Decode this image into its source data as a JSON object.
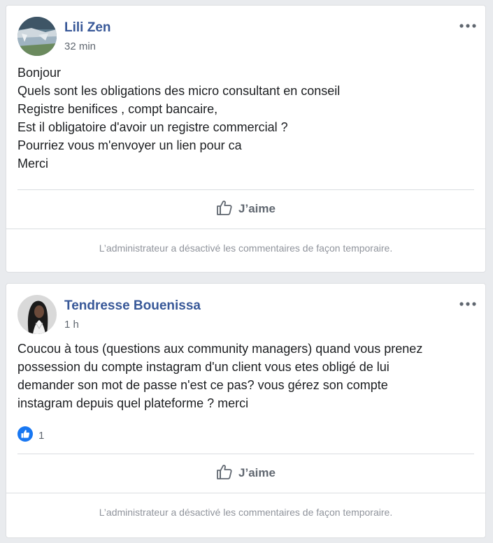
{
  "posts": [
    {
      "author": "Lili Zen",
      "time": "32 min",
      "body": [
        "Bonjour",
        "Quels sont les obligations des micro consultant en conseil",
        "Registre benifices , compt bancaire,",
        "Est il obligatoire d'avoir un registre commercial ?",
        "Pourriez vous m'envoyer un lien pour ca",
        "Merci"
      ],
      "like_label": "J’aime",
      "comments_disabled": "L’administrateur a désactivé les commentaires de façon temporaire."
    },
    {
      "author": "Tendresse Bouenissa",
      "time": "1 h",
      "body": [
        "Coucou à tous (questions aux community managers) quand vous prenez",
        "possession du compte instagram d'un client vous etes obligé de lui",
        "demander son mot de passe n'est ce pas? vous gérez son compte",
        "instagram depuis quel plateforme ? merci"
      ],
      "reaction_count": "1",
      "like_label": "J’aime",
      "comments_disabled": "L’administrateur a désactivé les commentaires de façon temporaire."
    }
  ],
  "icons": {
    "more": "more-options-icon",
    "like": "thumbs-up-icon",
    "reaction": "like-reaction-icon"
  },
  "colors": {
    "author": "#385898",
    "like_blue": "#1877f2",
    "muted": "#606770",
    "background": "#e9ebee"
  }
}
